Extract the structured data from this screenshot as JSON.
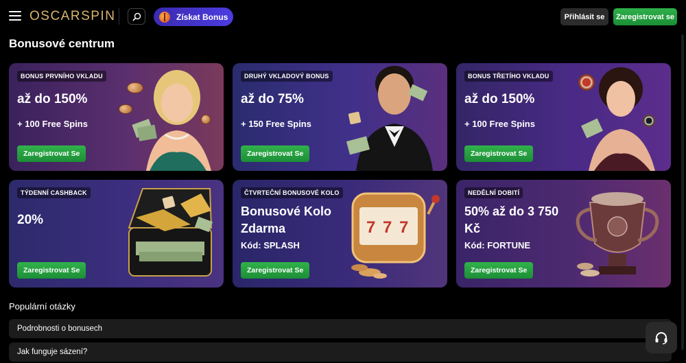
{
  "header": {
    "logo": "OSCARSPIN",
    "bonus_button": "Získat Bonus",
    "login": "Přihlásit se",
    "register": "Zaregistrovat se"
  },
  "page_title": "Bonusové centrum",
  "cards": [
    {
      "tag": "BONUS PRVNÍHO VKLADU",
      "amount": "až do 150%",
      "sub": "+ 100 Free Spins",
      "cta": "Zaregistrovat Se"
    },
    {
      "tag": "DRUHÝ VKLADOVÝ BONUS",
      "amount": "až do 75%",
      "sub": "+ 150 Free Spins",
      "cta": "Zaregistrovat Se"
    },
    {
      "tag": "BONUS TŘETÍHO VKLADU",
      "amount": "až do 150%",
      "sub": "+ 100 Free Spins",
      "cta": "Zaregistrovat Se"
    },
    {
      "tag": "TÝDENNÍ CASHBACK",
      "amount": "20%",
      "sub": "",
      "cta": "Zaregistrovat Se"
    },
    {
      "tag": "ČTVRTEČNÍ BONUSOVÉ KOLO",
      "amount": "Bonusové Kolo Zdarma",
      "sub": "Kód: SPLASH",
      "cta": "Zaregistrovat Se"
    },
    {
      "tag": "NEDĚLNÍ DOBITÍ",
      "amount": "50% až do 3 750 Kč",
      "sub": "Kód: FORTUNE",
      "cta": "Zaregistrovat Se"
    }
  ],
  "faq": {
    "title": "Populární otázky",
    "items": [
      "Podrobnosti o bonusech",
      "Jak funguje sázení?"
    ]
  },
  "icons": {
    "menu": "hamburger-icon",
    "search": "search-icon",
    "gift": "gift-icon",
    "support": "headset-icon"
  },
  "colors": {
    "accent_green": "#2fb04a",
    "bonus_purple": "#4c3ce0",
    "logo_gold": "#d9b56c"
  }
}
